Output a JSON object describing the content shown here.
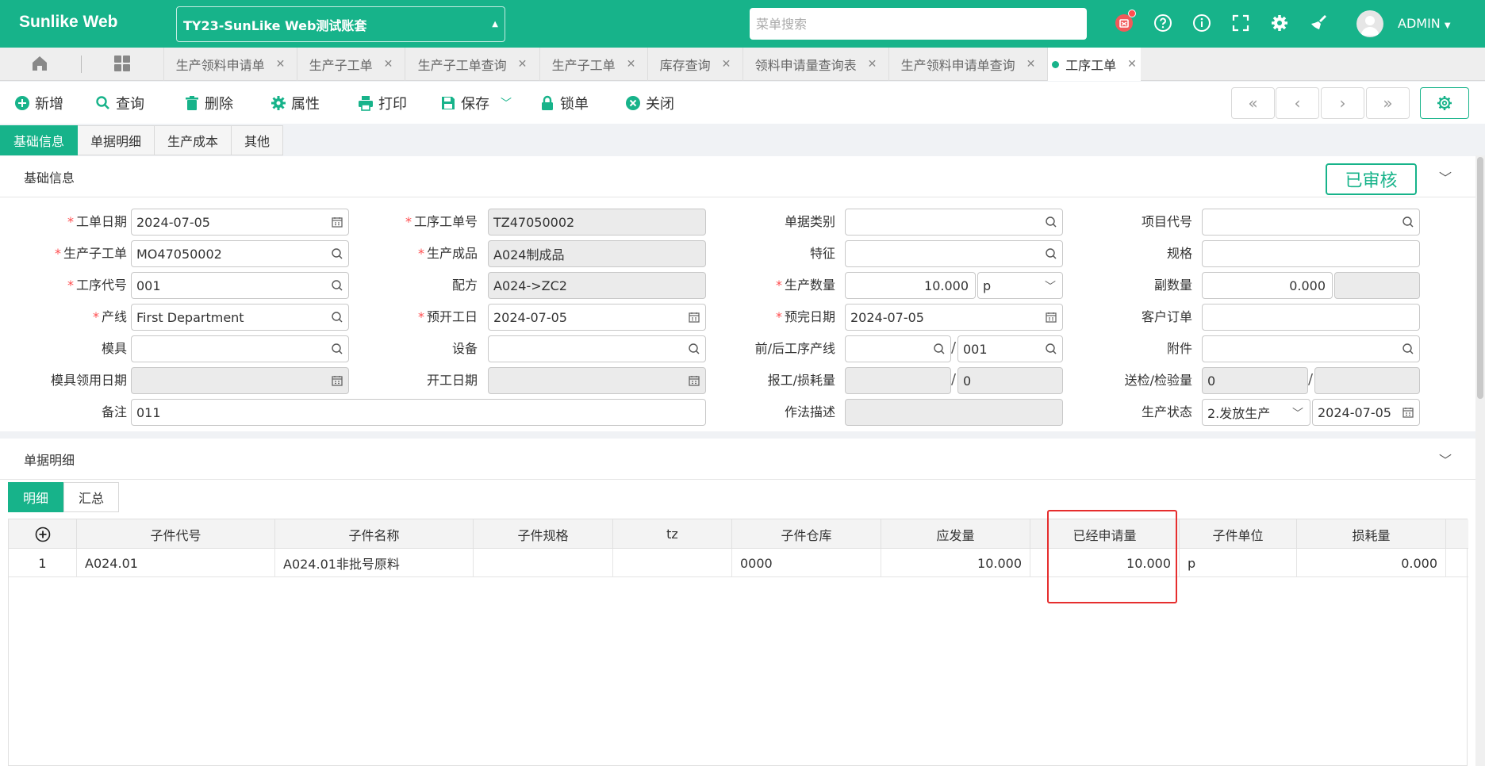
{
  "app": {
    "brand": "Sunlike Web",
    "account": "TY23-SunLike Web测试账套",
    "search_placeholder": "菜单搜索",
    "user": "ADMIN"
  },
  "tabs": [
    {
      "label": "生产领料申请单"
    },
    {
      "label": "生产子工单"
    },
    {
      "label": "生产子工单查询"
    },
    {
      "label": "生产子工单"
    },
    {
      "label": "库存查询"
    },
    {
      "label": "领料申请量查询表"
    },
    {
      "label": "生产领料申请单查询"
    },
    {
      "label": "工序工单",
      "active": true
    }
  ],
  "toolbar": {
    "new": "新增",
    "query": "查询",
    "delete": "删除",
    "props": "属性",
    "print": "打印",
    "save": "保存",
    "lock": "锁单",
    "close": "关闭"
  },
  "section_tabs": [
    "基础信息",
    "单据明细",
    "生产成本",
    "其他"
  ],
  "basic": {
    "title": "基础信息",
    "status": "已审核",
    "labels": {
      "work_date": "工单日期",
      "op_order_no": "工序工单号",
      "doc_type": "单据类别",
      "project_code": "项目代号",
      "sub_order": "生产子工单",
      "product": "生产成品",
      "feature": "特征",
      "spec": "规格",
      "op_code": "工序代号",
      "formula": "配方",
      "prod_qty": "生产数量",
      "sub_qty": "副数量",
      "line": "产线",
      "plan_start": "预开工日",
      "plan_end": "预完日期",
      "cust_order": "客户订单",
      "mold": "模具",
      "equipment": "设备",
      "prev_next_line": "前/后工序产线",
      "attachment": "附件",
      "mold_date": "模具领用日期",
      "start_date": "开工日期",
      "report_loss": "报工/损耗量",
      "inspect_qty": "送检/检验量",
      "remark": "备注",
      "method": "作法描述",
      "prod_status": "生产状态"
    },
    "values": {
      "work_date": "2024-07-05",
      "op_order_no": "TZ47050002",
      "doc_type": "",
      "project_code": "",
      "sub_order": "MO47050002",
      "product": "A024制成品",
      "feature": "",
      "spec": "",
      "op_code": "001",
      "formula": "A024->ZC2",
      "prod_qty": "10.000",
      "prod_unit": "p",
      "sub_qty": "0.000",
      "sub_qty_unit": "",
      "line": "First Department",
      "plan_start": "2024-07-05",
      "plan_end": "2024-07-05",
      "cust_order": "",
      "mold": "",
      "equipment": "",
      "prev_line": "",
      "next_line": "001",
      "attachment": "",
      "mold_date": "",
      "start_date": "",
      "report_qty": "",
      "loss_qty": "0",
      "send_inspect": "0",
      "inspected": "",
      "remark": "011",
      "method": "",
      "prod_status": "2.发放生产",
      "status_date": "2024-07-05"
    }
  },
  "detail": {
    "title": "单据明细",
    "subtabs": [
      "明细",
      "汇总"
    ],
    "columns": [
      "子件代号",
      "子件名称",
      "子件规格",
      "tz",
      "子件仓库",
      "应发量",
      "已经申请量",
      "子件单位",
      "损耗量"
    ],
    "rows": [
      {
        "no": "1",
        "code": "A024.01",
        "name": "A024.01非批号原料",
        "spec": "",
        "tz": "",
        "warehouse": "0000",
        "issue_qty": "10.000",
        "applied_qty": "10.000",
        "unit": "p",
        "loss": "0.000"
      }
    ]
  },
  "colors": {
    "accent": "#17b38a",
    "required": "#ff4d4f",
    "highlight": "#e62e2e"
  }
}
